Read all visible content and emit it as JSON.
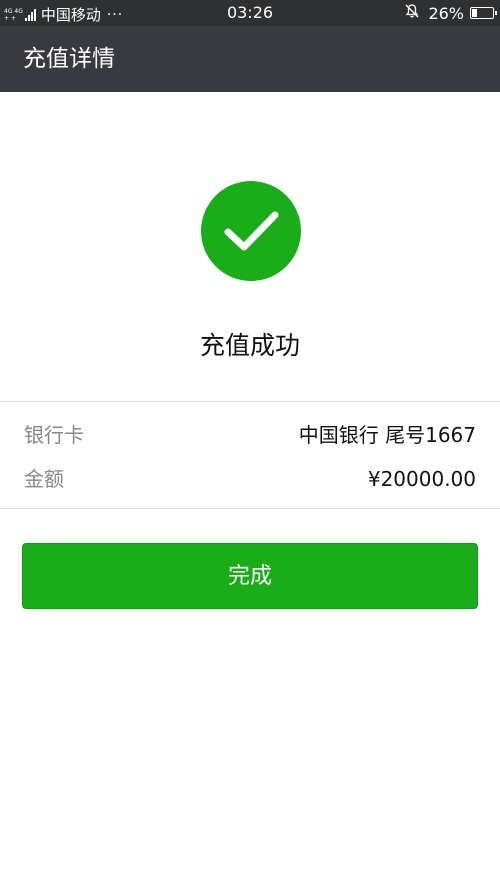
{
  "status_bar": {
    "network_type_top": "4G 4G",
    "network_type_bottom": "+ +",
    "carrier": "中国移动",
    "more": "···",
    "time": "03:26",
    "battery_percent": "26%",
    "battery_level": 0.26,
    "icons": [
      "signal-icon",
      "bell-muted-icon",
      "battery-icon"
    ]
  },
  "nav": {
    "title": "充值详情"
  },
  "result": {
    "icon": "checkmark-circle-icon",
    "icon_color": "#1aad19",
    "text": "充值成功"
  },
  "details": {
    "rows": [
      {
        "label": "银行卡",
        "value": "中国银行 尾号1667"
      },
      {
        "label": "金额",
        "value": "¥20000.00"
      }
    ]
  },
  "actions": {
    "done_label": "完成",
    "accent_color": "#1aad19"
  }
}
